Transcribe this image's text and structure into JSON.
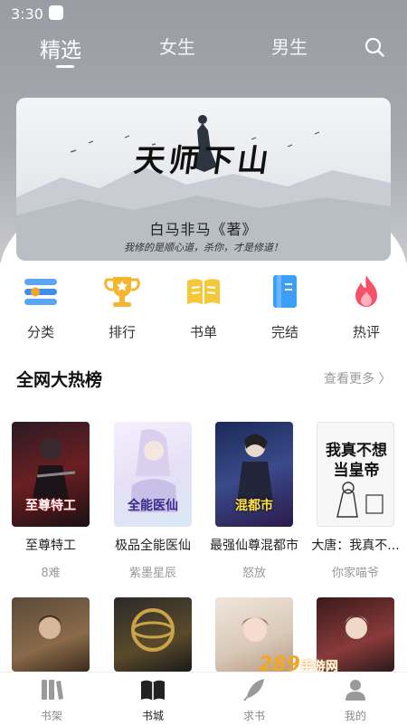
{
  "status": {
    "time": "3:30"
  },
  "tabs": [
    {
      "label": "精选",
      "active": true
    },
    {
      "label": "女生",
      "active": false
    },
    {
      "label": "男生",
      "active": false
    }
  ],
  "banner": {
    "title": "天师下山",
    "author": "白马非马《著》",
    "slogan": "我修的是顺心道，杀你，才是修道！"
  },
  "quick_nav": [
    {
      "label": "分类",
      "icon": "category-icon",
      "color": "#3d8ef0"
    },
    {
      "label": "排行",
      "icon": "trophy-icon",
      "color": "#f5b52e"
    },
    {
      "label": "书单",
      "icon": "book-list-icon",
      "color": "#f5c83a"
    },
    {
      "label": "完结",
      "icon": "finished-book-icon",
      "color": "#3d9ef5"
    },
    {
      "label": "热评",
      "icon": "flame-icon",
      "color": "#f5526a"
    }
  ],
  "hot_section": {
    "title": "全网大热榜",
    "more": "查看更多 〉"
  },
  "books_row1": [
    {
      "title": "至尊特工",
      "author": "8难",
      "cover_text": "至尊特工"
    },
    {
      "title": "极品全能医仙",
      "author": "紫墨星辰",
      "cover_text": "全能医仙"
    },
    {
      "title": "最强仙尊混都市",
      "author": "怒放",
      "cover_text": "混都市"
    },
    {
      "title": "大唐：我真不...",
      "author": "你家喵爷",
      "cover_text": "我真不想当皇帝"
    }
  ],
  "bottom_nav": [
    {
      "label": "书架",
      "icon": "bookshelf-icon",
      "active": false
    },
    {
      "label": "书城",
      "icon": "bookstore-icon",
      "active": true
    },
    {
      "label": "求书",
      "icon": "quill-icon",
      "active": false
    },
    {
      "label": "我的",
      "icon": "profile-icon",
      "active": false
    }
  ],
  "watermark": {
    "text": "289",
    "suffix": "手游网"
  }
}
